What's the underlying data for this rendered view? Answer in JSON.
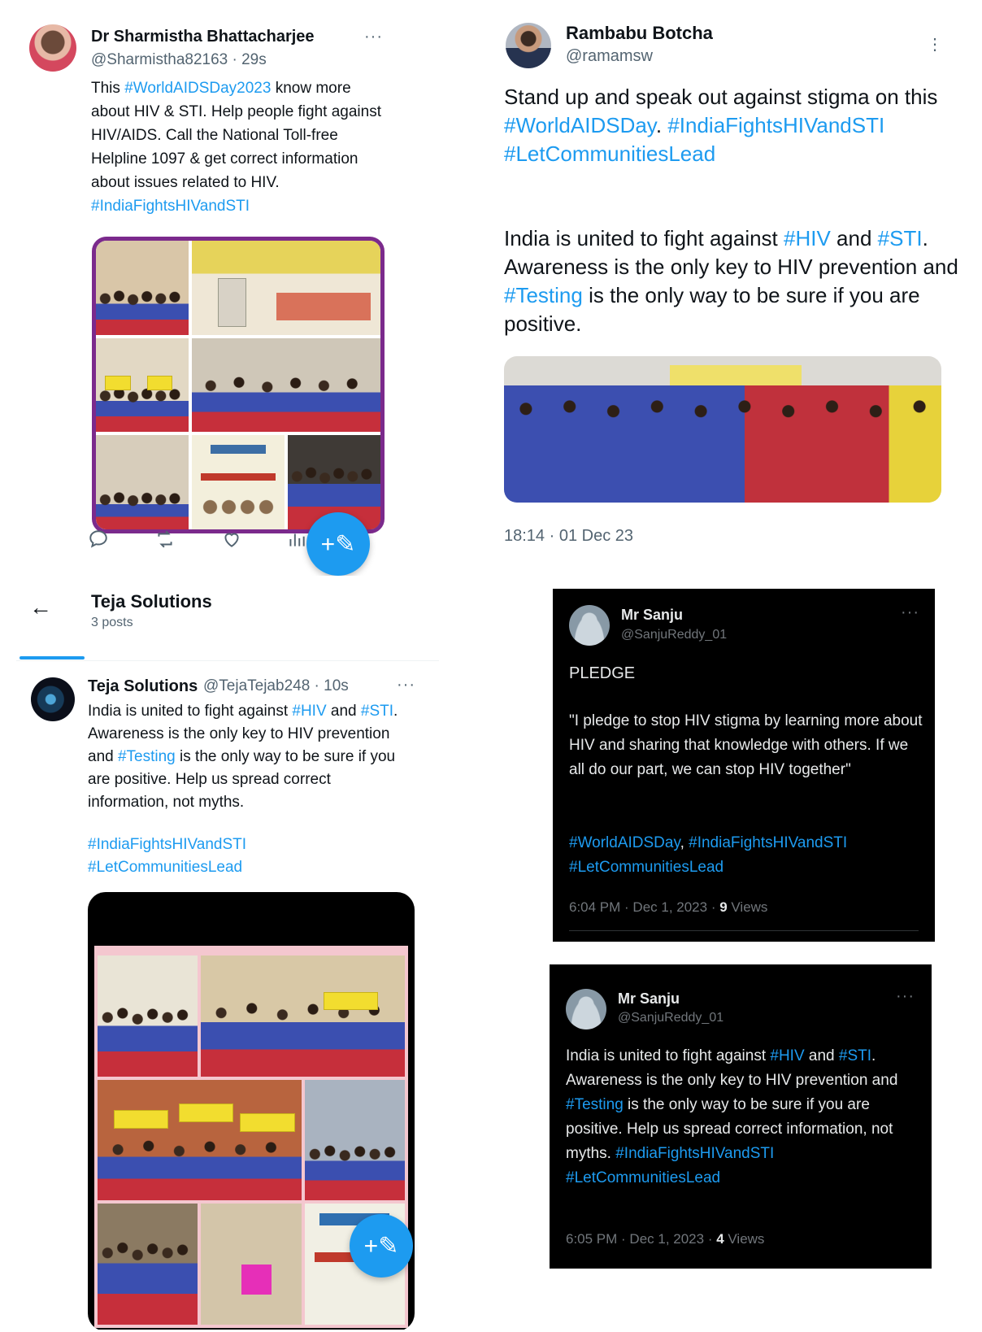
{
  "tweet1": {
    "name": "Dr Sharmistha Bhattacharjee",
    "handle": "@Sharmistha82163 · 29s",
    "more": "···",
    "segments": [
      {
        "t": "This ",
        "h": false
      },
      {
        "t": "#WorldAIDSDay2023",
        "h": true
      },
      {
        "t": " know more about HIV & STI. Help people fight against HIV/AIDS. Call the National Toll-free Helpline 1097 & get correct information about issues related to HIV. ",
        "h": false
      },
      {
        "t": "#IndiaFightsHIVandSTI",
        "h": true
      }
    ],
    "fab_icon": "+✎",
    "colors": {
      "collage_border": "#7b2a8c",
      "accent": "#1d9bf0"
    }
  },
  "tweet2": {
    "name": "Rambabu Botcha",
    "handle": "@ramamsw",
    "more": "⋮",
    "para1": [
      {
        "t": "Stand up and speak out against stigma on this ",
        "h": false
      },
      {
        "t": "#WorldAIDSDay",
        "h": true
      },
      {
        "t": ". ",
        "h": false
      },
      {
        "t": "#IndiaFightsHIVandSTI",
        "h": true
      },
      {
        "t": " ",
        "h": false
      },
      {
        "t": "#LetCommunitiesLead",
        "h": true
      }
    ],
    "para2": [
      {
        "t": "India is united to fight against ",
        "h": false
      },
      {
        "t": "#HIV",
        "h": true
      },
      {
        "t": " and ",
        "h": false
      },
      {
        "t": "#STI",
        "h": true
      },
      {
        "t": ". Awareness is the only key to HIV prevention and ",
        "h": false
      },
      {
        "t": "#Testing",
        "h": true
      },
      {
        "t": " is the only way to be sure if you are positive.",
        "h": false
      }
    ],
    "timestamp": "18:14 · 01 Dec 23"
  },
  "tweet3": {
    "header_title": "Teja Solutions",
    "header_sub": "3 posts",
    "back_icon": "←",
    "name": "Teja Solutions",
    "handle": "@TejaTejab248 · 10s",
    "more": "···",
    "segments": [
      {
        "t": "India is united to fight against ",
        "h": false
      },
      {
        "t": "#HIV",
        "h": true
      },
      {
        "t": " and ",
        "h": false
      },
      {
        "t": "#STI",
        "h": true
      },
      {
        "t": ". Awareness is the only key to HIV prevention and ",
        "h": false
      },
      {
        "t": "#Testing",
        "h": true
      },
      {
        "t": " is the only way to be sure if you are positive. Help us spread correct information, not myths.",
        "h": false
      }
    ],
    "tags": [
      {
        "t": "#IndiaFightsHIVandSTI",
        "h": true
      },
      {
        "t": "#LetCommunitiesLead",
        "h": true
      }
    ],
    "fab_icon": "+✎"
  },
  "tweet4": {
    "name": "Mr Sanju",
    "handle": "@SanjuReddy_01",
    "more": "···",
    "title": "PLEDGE",
    "quote": "\"I pledge to stop HIV stigma by learning more about HIV and sharing that knowledge with others. If we all do our part, we can stop HIV together\"",
    "tags": [
      {
        "t": "#WorldAIDSDay",
        "h": true
      },
      {
        "t": ", ",
        "h": false
      },
      {
        "t": "#IndiaFightsHIVandSTI",
        "h": true
      },
      {
        "t": " ",
        "h": false
      },
      {
        "t": "#LetCommunitiesLead",
        "h": true
      }
    ],
    "time": "6:04 PM · Dec 1, 2023 · ",
    "views_count": "9",
    "views_label": " Views"
  },
  "tweet5": {
    "name": "Mr Sanju",
    "handle": "@SanjuReddy_01",
    "more": "···",
    "segments": [
      {
        "t": "India is united to fight against ",
        "h": false
      },
      {
        "t": "#HIV",
        "h": true
      },
      {
        "t": " and ",
        "h": false
      },
      {
        "t": "#STI",
        "h": true
      },
      {
        "t": ". Awareness is the only key to HIV prevention and ",
        "h": false
      },
      {
        "t": "#Testing",
        "h": true
      },
      {
        "t": " is the only way to be sure if you are positive. Help us spread correct information, not myths. ",
        "h": false
      },
      {
        "t": "#IndiaFightsHIVandSTI",
        "h": true
      },
      {
        "t": " ",
        "h": false
      },
      {
        "t": "#LetCommunitiesLead",
        "h": true
      }
    ],
    "time": "6:05 PM · Dec 1, 2023 · ",
    "views_count": "4",
    "views_label": " Views"
  }
}
